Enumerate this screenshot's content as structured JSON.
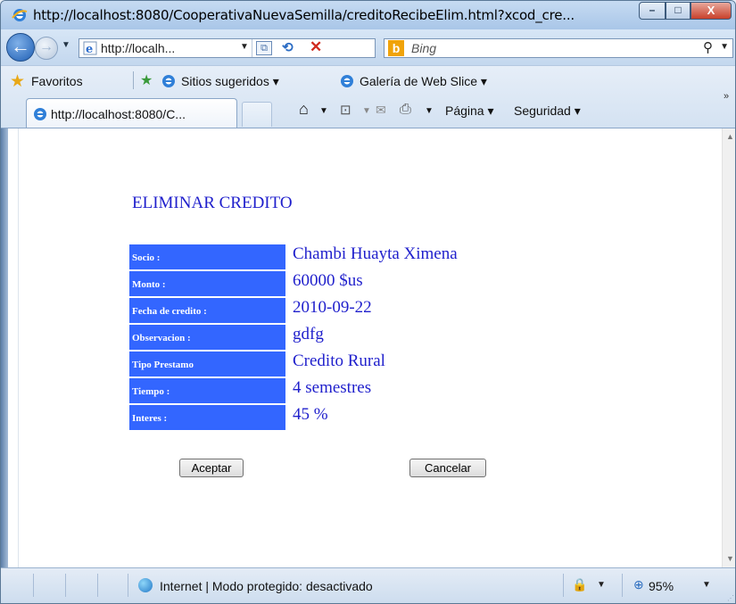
{
  "window": {
    "title": "http://localhost:8080/CooperativaNuevaSemilla/creditoRecibeElim.html?xcod_cre...",
    "min_glyph": "–",
    "max_glyph": "□",
    "close_glyph": "X"
  },
  "addressbar": {
    "url": "http://localh...",
    "search_placeholder": "Bing"
  },
  "favorites_bar": {
    "label": "Favoritos",
    "items": [
      "Sitios sugeridos ▾",
      "Galería de Web Slice ▾"
    ]
  },
  "tabs": [
    {
      "label": "http://localhost:8080/C..."
    }
  ],
  "command_bar": {
    "page": "Página ▾",
    "safety": "Seguridad ▾"
  },
  "page": {
    "heading": "ELIMINAR CREDITO",
    "fields": [
      {
        "label": "Socio :",
        "value": "Chambi Huayta Ximena"
      },
      {
        "label": "Monto :",
        "value": "60000 $us"
      },
      {
        "label": "Fecha de credito :",
        "value": "2010-09-22"
      },
      {
        "label": "Observacion :",
        "value": "gdfg"
      },
      {
        "label": "Tipo Prestamo",
        "value": "Credito Rural"
      },
      {
        "label": "Tiempo :",
        "value": "4 semestres"
      },
      {
        "label": "Interes :",
        "value": "45 %"
      }
    ],
    "accept_label": "Aceptar",
    "cancel_label": "Cancelar"
  },
  "statusbar": {
    "zone": "Internet | Modo protegido: desactivado",
    "zoom": "95%"
  },
  "colors": {
    "label_bg": "#3366ff",
    "text_blue": "#1f1fcc"
  }
}
